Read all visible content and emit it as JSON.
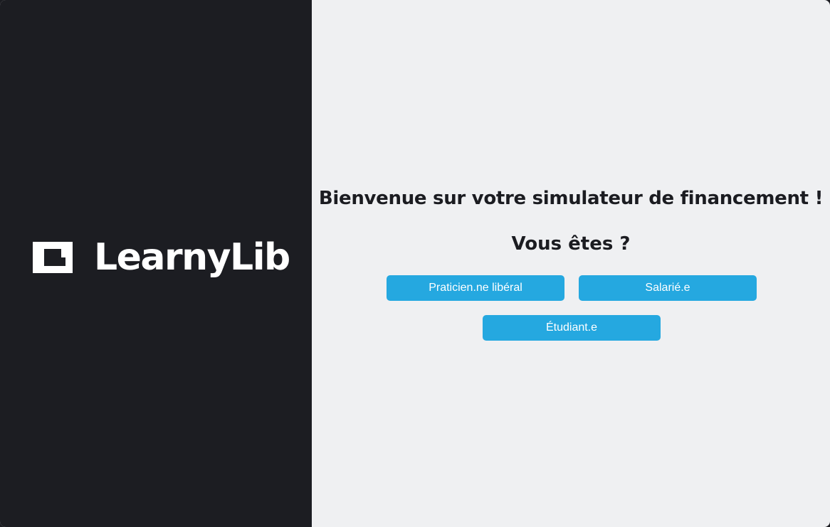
{
  "brand": {
    "name": "LearnyLib",
    "icon": "learnylib-logo-icon"
  },
  "main": {
    "welcome": "Bienvenue sur votre simulateur de financement !",
    "question": "Vous êtes ?",
    "options": {
      "liberal": "Praticien.ne libéral",
      "salarie": "Salarié.e",
      "etudiant": "Étudiant.e"
    }
  },
  "colors": {
    "sidebar_bg": "#1c1d22",
    "main_bg": "#eff0f2",
    "accent": "#25a8e0",
    "text_dark": "#1b1c21"
  }
}
